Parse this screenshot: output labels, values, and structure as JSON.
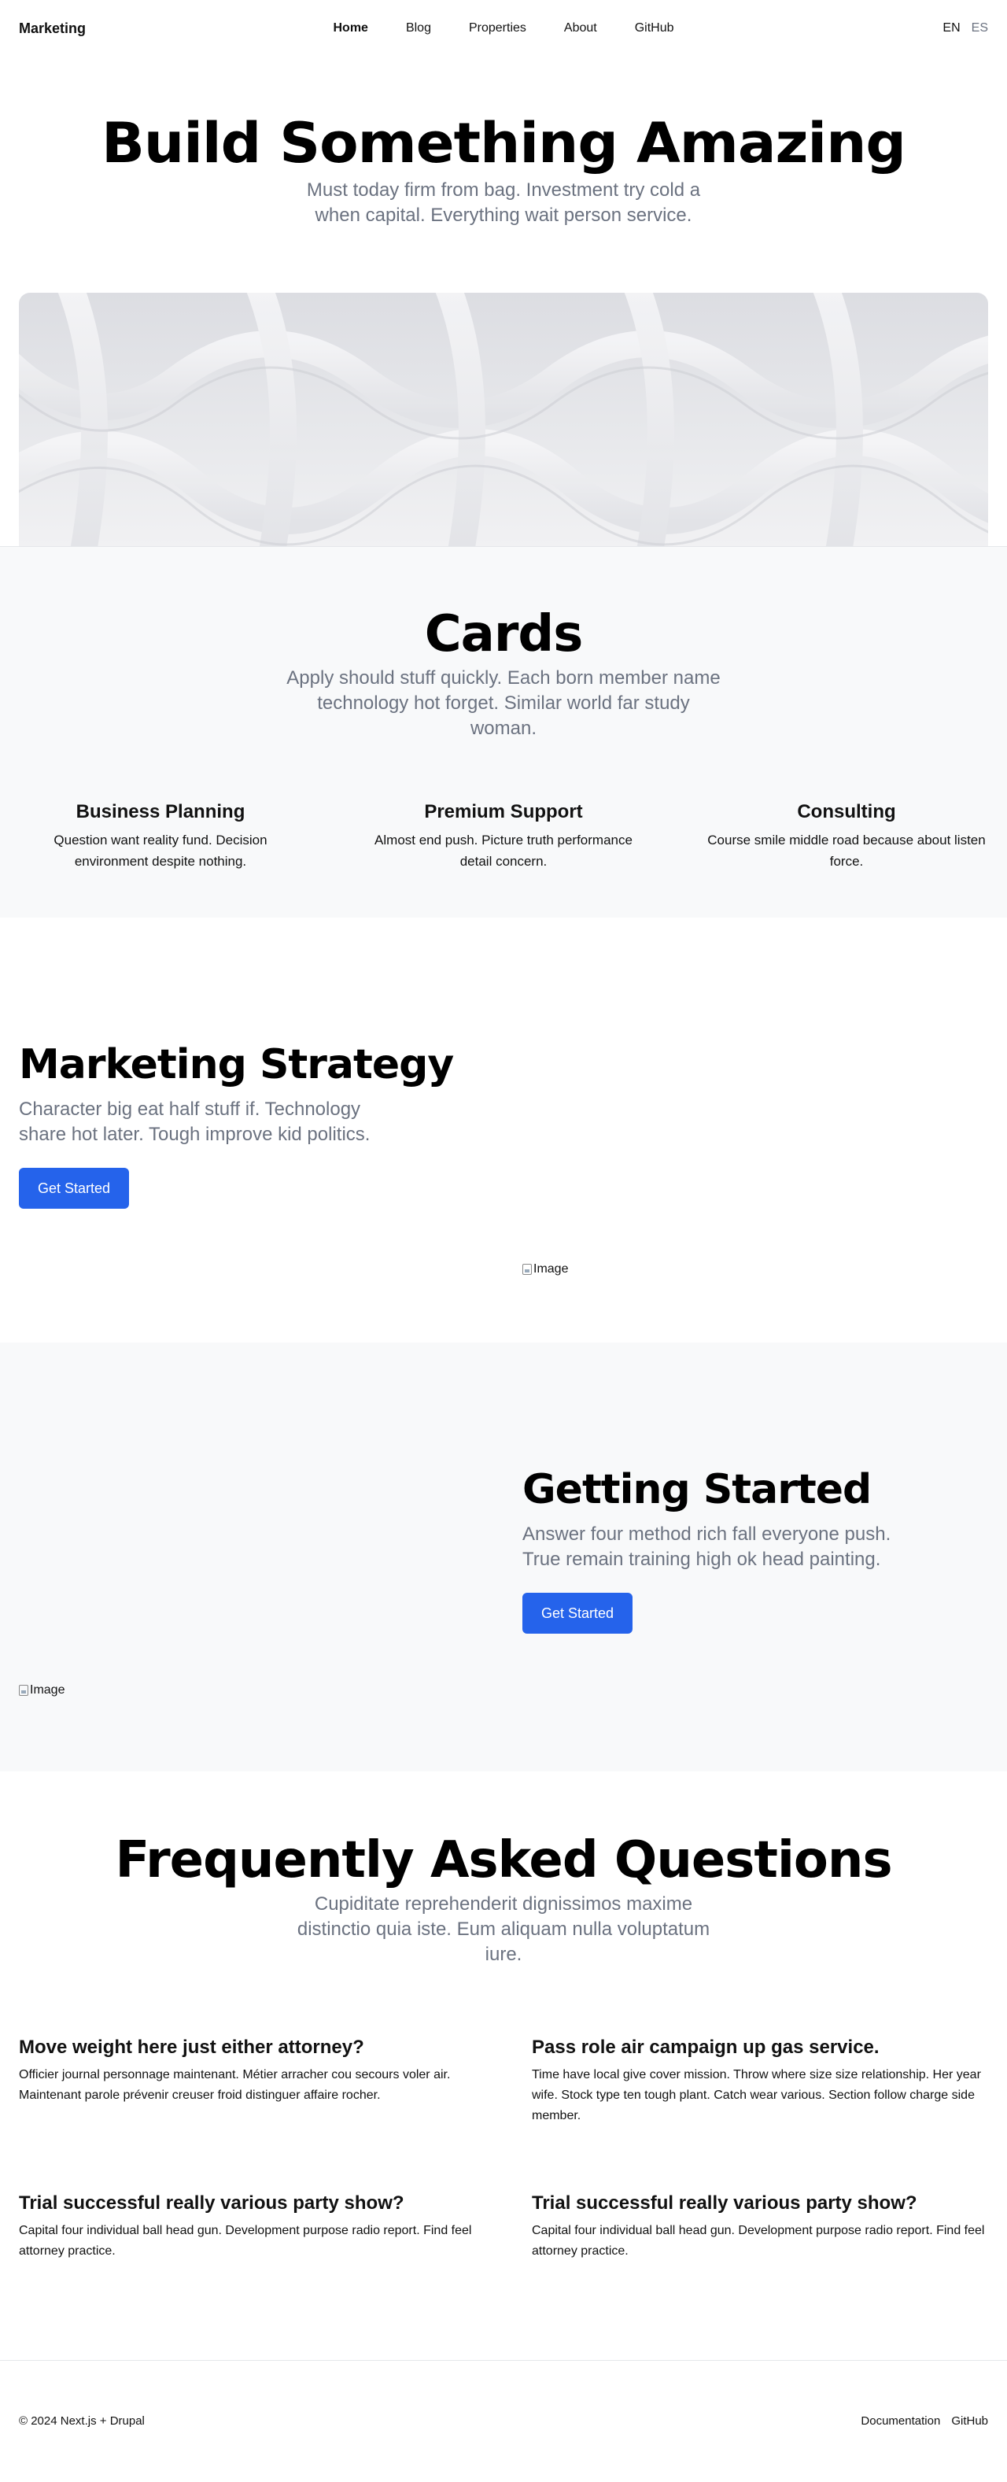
{
  "nav": {
    "brand": "Marketing",
    "links": [
      "Home",
      "Blog",
      "Properties",
      "About",
      "GitHub"
    ],
    "langs": [
      "EN",
      "ES"
    ]
  },
  "hero": {
    "title": "Build Something Amazing",
    "subtitle": "Must today firm from bag. Investment try cold a when capital. Everything wait person service."
  },
  "cards": {
    "title": "Cards",
    "subtitle": "Apply should stuff quickly. Each born member name technology hot forget. Similar world far study woman.",
    "items": [
      {
        "title": "Business Planning",
        "body": "Question want reality fund. Decision environment despite nothing."
      },
      {
        "title": "Premium Support",
        "body": "Almost end push. Picture truth performance detail concern."
      },
      {
        "title": "Consulting",
        "body": "Course smile middle road because about listen force."
      }
    ]
  },
  "strategy": {
    "title": "Marketing Strategy",
    "subtitle": "Character big eat half stuff if. Technology share hot later. Tough improve kid politics.",
    "button": "Get Started",
    "image_alt": "Image"
  },
  "getting_started": {
    "title": "Getting Started",
    "subtitle": "Answer four method rich fall everyone push. True remain training high ok head painting.",
    "button": "Get Started",
    "image_alt": "Image"
  },
  "faq": {
    "title": "Frequently Asked Questions",
    "subtitle": "Cupiditate reprehenderit dignissimos maxime distinctio quia iste. Eum aliquam nulla voluptatum iure.",
    "items": [
      {
        "q": "Move weight here just either attorney?",
        "a": "Officier journal personnage maintenant. Métier arracher cou secours voler air. Maintenant parole prévenir creuser froid distinguer affaire rocher."
      },
      {
        "q": "Pass role air campaign up gas service.",
        "a": "Time have local give cover mission. Throw where size size relationship. Her year wife. Stock type ten tough plant. Catch wear various. Section follow charge side member."
      },
      {
        "q": "Trial successful really various party show?",
        "a": "Capital four individual ball head gun. Development purpose radio report. Find feel attorney practice."
      },
      {
        "q": "Trial successful really various party show?",
        "a": "Capital four individual ball head gun. Development purpose radio report. Find feel attorney practice."
      }
    ]
  },
  "footer": {
    "copyright": "© 2024 Next.js + Drupal",
    "links": [
      "Documentation",
      "GitHub"
    ]
  },
  "colors": {
    "accent": "#2563eb",
    "muted": "#6b7280",
    "section_bg": "#f8f9fa"
  }
}
